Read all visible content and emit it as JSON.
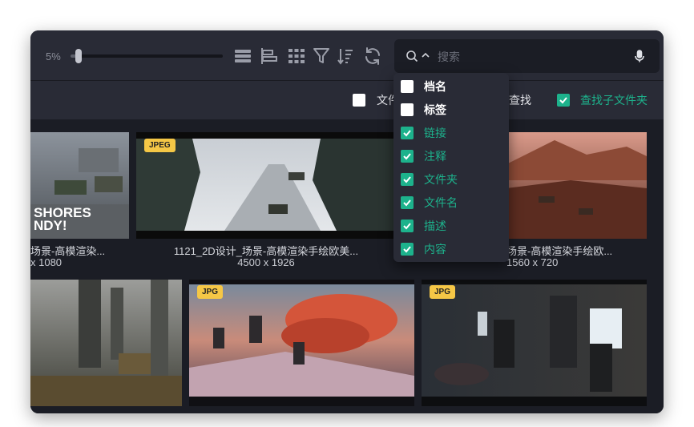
{
  "toolbar": {
    "zoom_label": "5%",
    "zoom_value": 0.05,
    "icons": [
      "list-view-icon",
      "align-left-icon",
      "grid-view-icon",
      "filter-icon",
      "sort-icon",
      "refresh-icon"
    ]
  },
  "search": {
    "placeholder": "搜索",
    "value": ""
  },
  "filter_bar": {
    "items": [
      {
        "label": "文件",
        "checked": false
      },
      {
        "label": "查找",
        "checked": false
      },
      {
        "label": "查找子文件夹",
        "checked": true
      }
    ]
  },
  "dropdown": {
    "items": [
      {
        "label": "档名",
        "checked": false
      },
      {
        "label": "标签",
        "checked": false
      },
      {
        "label": "链接",
        "checked": true
      },
      {
        "label": "注释",
        "checked": true
      },
      {
        "label": "文件夹",
        "checked": true
      },
      {
        "label": "文件名",
        "checked": true
      },
      {
        "label": "描述",
        "checked": true
      },
      {
        "label": "内容",
        "checked": true
      }
    ]
  },
  "gallery": {
    "row1": [
      {
        "badge": "",
        "name": "场景-高模渲染...",
        "size": "x 1080",
        "overlay_text": "SHORES\nNDY!"
      },
      {
        "badge": "JPEG",
        "name": "1121_2D设计_场景-高模渲染手绘欧美...",
        "size": "4500 x 1926"
      },
      {
        "badge": "",
        "name": "场景-高模渲染手绘欧...",
        "size": "1560 x 720"
      }
    ],
    "row2": [
      {
        "badge": ""
      },
      {
        "badge": "JPG"
      },
      {
        "badge": "JPG"
      }
    ]
  },
  "colors": {
    "accent": "#1db28c",
    "badge": "#f5c746",
    "toolbar_bg": "#292b36",
    "content_bg": "#1b1d25"
  }
}
